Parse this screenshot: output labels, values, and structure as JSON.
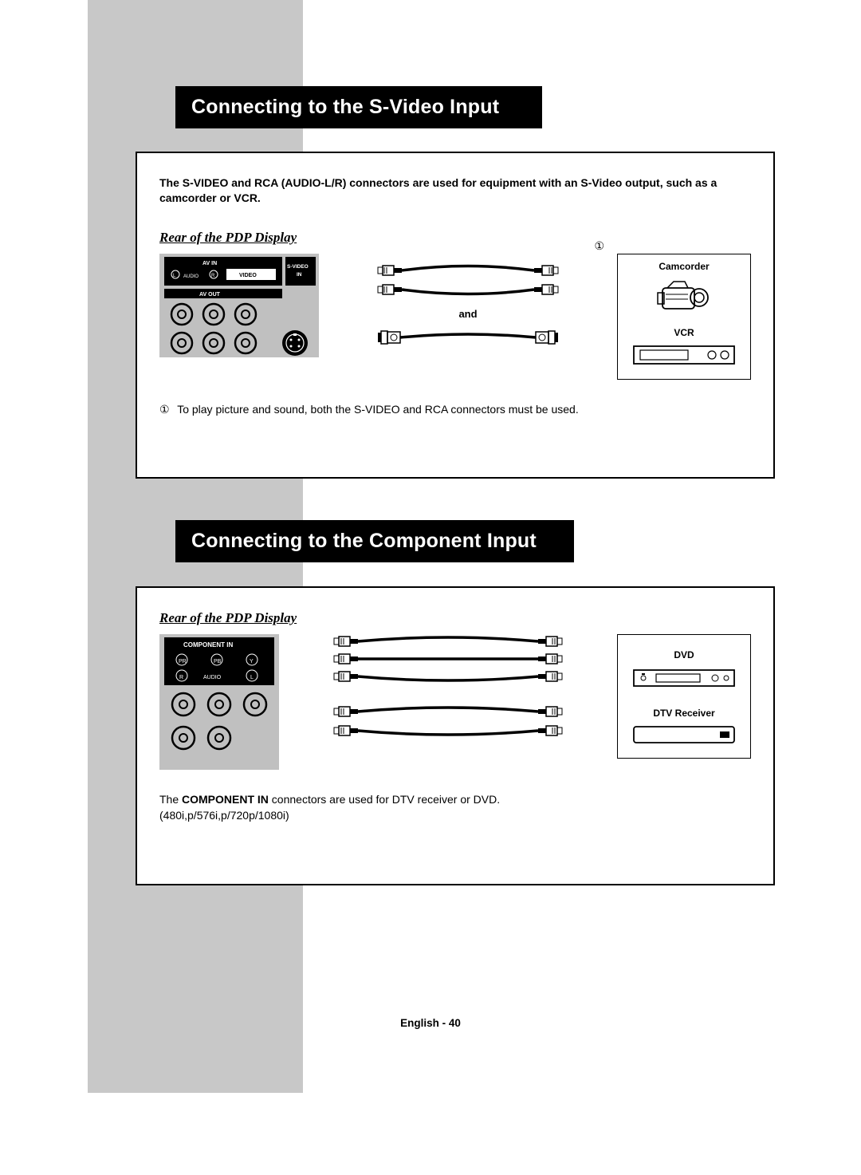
{
  "section1": {
    "title": "Connecting to the S-Video Input",
    "intro": "The S-VIDEO and RCA (AUDIO-L/R) connectors are used for equipment with an S-Video output, such as a camcorder or VCR.",
    "rear_label": "Rear of the PDP Display",
    "marker_top": "①",
    "cable_and": "and",
    "devices": {
      "camcorder": "Camcorder",
      "vcr": "VCR"
    },
    "note_marker": "①",
    "note_text": "To play picture and sound, both the S-VIDEO and RCA connectors must be used.",
    "panel_labels": {
      "av_in": "AV IN",
      "audio": "AUDIO",
      "video": "VIDEO",
      "svideo_in": "S-VIDEO IN",
      "av_out": "AV OUT",
      "l": "L",
      "r": "R"
    }
  },
  "section2": {
    "title": "Connecting to the Component Input",
    "rear_label": "Rear of the PDP Display",
    "devices": {
      "dvd": "DVD",
      "dtv": "DTV Receiver"
    },
    "note_pre": "The ",
    "note_bold": "COMPONENT IN",
    "note_post": " connectors are used for DTV receiver or DVD.",
    "note_line2": "(480i,p/576i,p/720p/1080i)",
    "panel_labels": {
      "component_in": "COMPONENT IN",
      "pr": "PR",
      "pb": "PB",
      "y": "Y",
      "audio": "AUDIO",
      "r": "R",
      "l": "L"
    }
  },
  "footer": "English - 40"
}
